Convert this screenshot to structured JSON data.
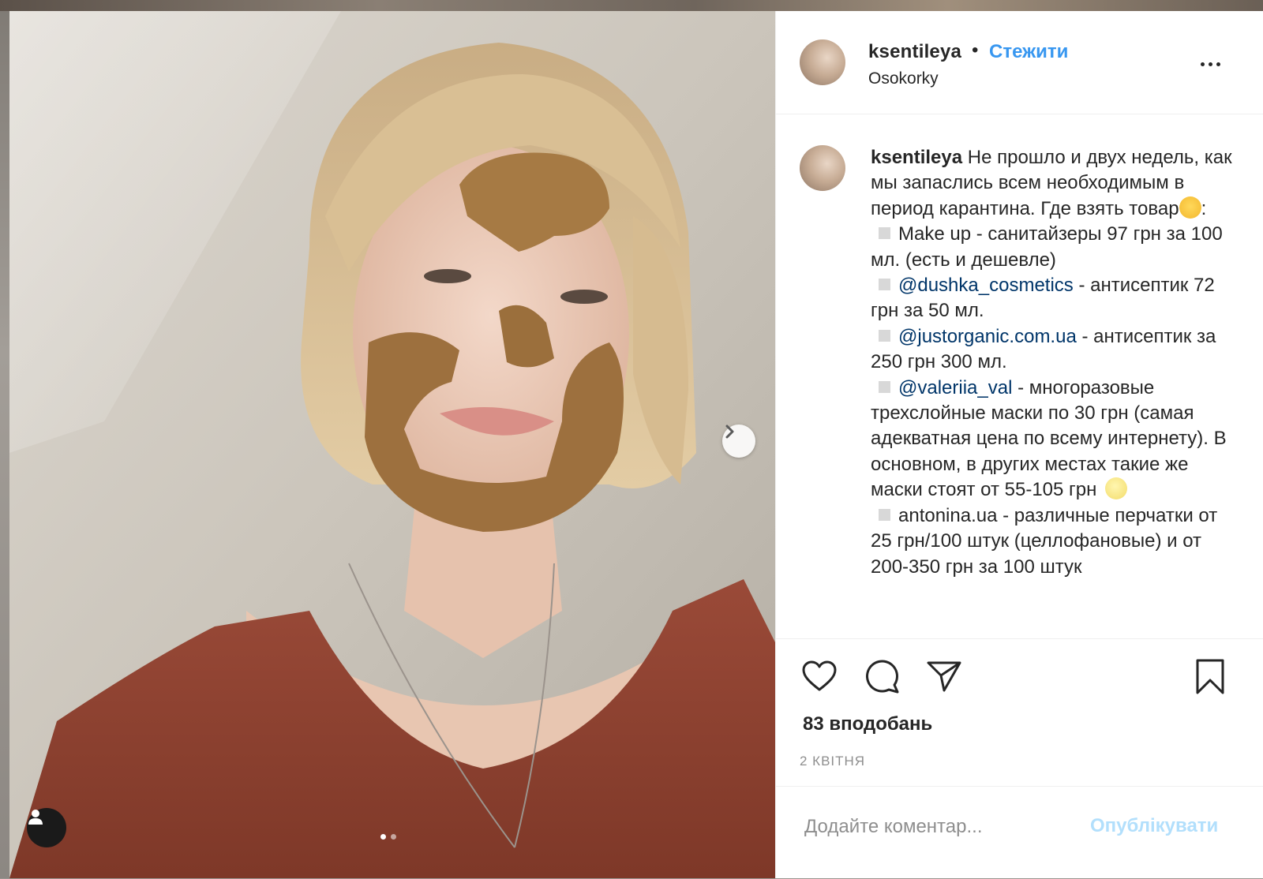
{
  "post": {
    "username": "ksentileya",
    "bullet": "•",
    "follow_label": "Стежити",
    "location": "Osokorky",
    "more_label": "...",
    "caption": {
      "username": "ksentileya",
      "line1": " Не прошло и двух недель, как мы запаслись всем необходимым в период карантина. Где взять товар",
      "line1_end": ":",
      "item1": "Make up - санитайзеры 97 грн за 100 мл. (есть и дешевле)",
      "item2_mention": "@dushka_cosmetics",
      "item2_text": " - антисептик 72 грн за 50 мл.",
      "item3_mention": "@justorganic.com.ua",
      "item3_text": " - антисептик за 250 грн 300 мл.",
      "item4_mention": "@valeriia_val",
      "item4_text": " - многоразовые трехслойные маски по 30 грн (самая адекватная цена по всему интернету). В основном, в других местах такие же маски стоят от 55-105 грн ",
      "item5": "antonina.ua - различные перчатки от 25 грн/100 штук (целлофановые) и от 200-350 грн за 100 штук"
    },
    "likes": "83 вподобань",
    "date": "2 КВІТНЯ",
    "comment": {
      "placeholder": "Додайте коментар...",
      "value": "",
      "publish_label": "Опублікувати"
    },
    "carousel": {
      "total": 2,
      "current": 1
    }
  },
  "icons": {
    "next": "chevron-right-icon",
    "user_tag": "user-icon",
    "like": "heart-icon",
    "comment": "speech-bubble-icon",
    "share": "paper-plane-icon",
    "save": "bookmark-icon",
    "more": "ellipsis-icon",
    "emoji1": "laughing-emoji-icon",
    "emoji2": "moon-face-emoji-icon"
  },
  "colors": {
    "link": "#3897f0",
    "mention": "#003569",
    "publish_disabled": "#b2dffc",
    "muted": "#8e8e8e",
    "text": "#262626"
  }
}
